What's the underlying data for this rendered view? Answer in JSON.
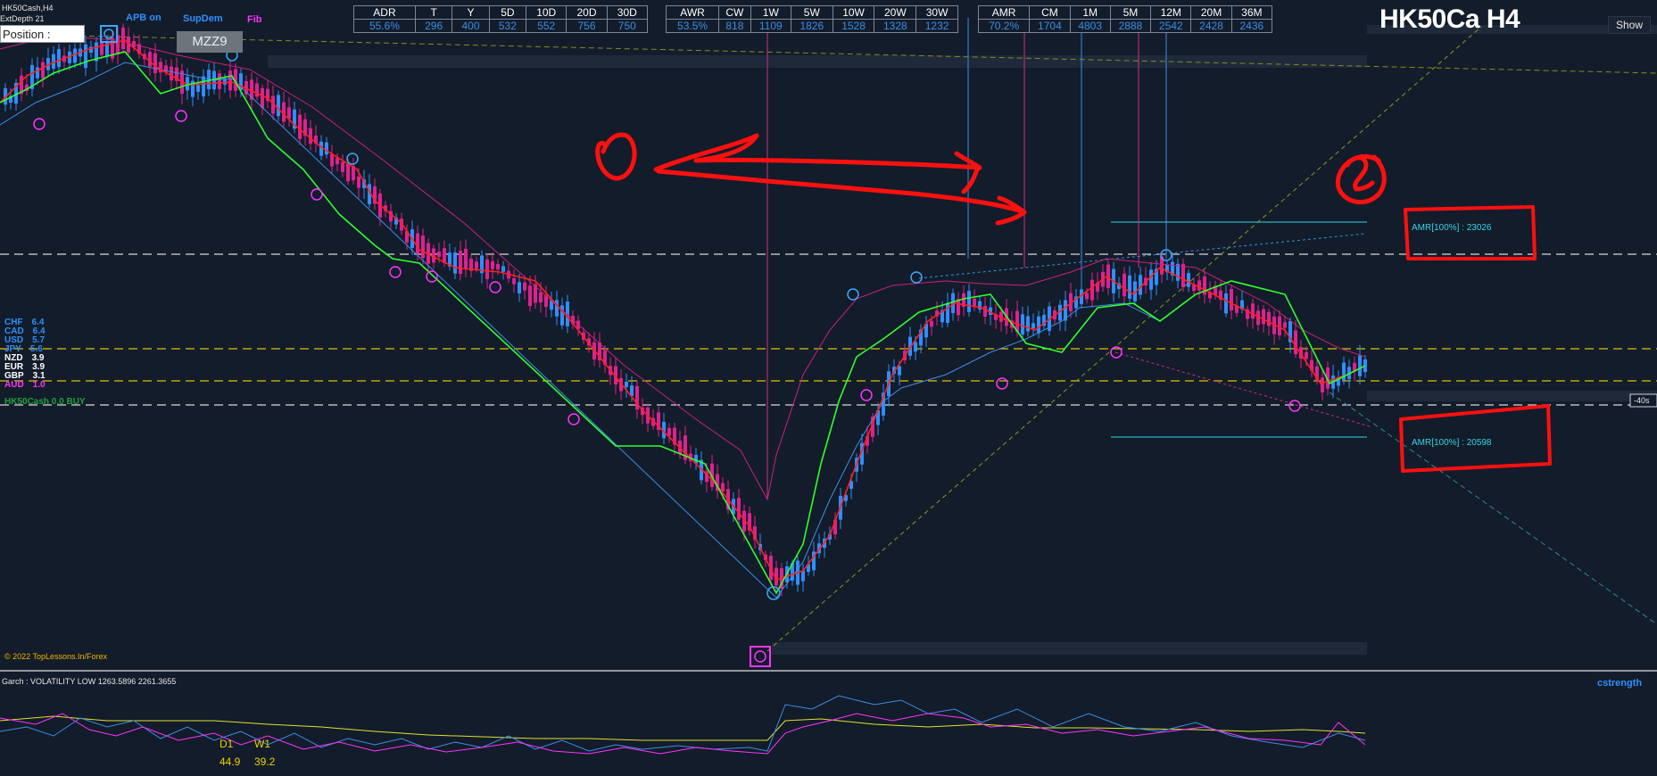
{
  "symbol_info": {
    "line1": "HK50Cash,H4",
    "line2": "ExtDepth  21"
  },
  "top_buttons": {
    "apb": "APB on",
    "supdem": "SupDem",
    "fib": "Fib",
    "position": "Position :",
    "mzz": "MZZ9"
  },
  "title": "HK50Ca H4",
  "show_button": "Show",
  "table1": {
    "headers": [
      "ADR",
      "T",
      "Y",
      "5D",
      "10D",
      "20D",
      "30D"
    ],
    "values": [
      "55.6%",
      "296",
      "400",
      "532",
      "552",
      "756",
      "750"
    ]
  },
  "table2": {
    "headers": [
      "AWR",
      "CW",
      "1W",
      "5W",
      "10W",
      "20W",
      "30W"
    ],
    "values": [
      "53.5%",
      "818",
      "1109",
      "1826",
      "1528",
      "1328",
      "1232"
    ]
  },
  "table3": {
    "headers": [
      "AMR",
      "CM",
      "1M",
      "5M",
      "12M",
      "20M",
      "36M"
    ],
    "values": [
      "70.2%",
      "1704",
      "4803",
      "2888",
      "2542",
      "2428",
      "2436"
    ]
  },
  "currency_strength": [
    {
      "name": "CHF",
      "value": "6.4",
      "color": "#2e8fff"
    },
    {
      "name": "CAD",
      "value": "6.4",
      "color": "#2e8fff"
    },
    {
      "name": "USD",
      "value": "5.7",
      "color": "#2e8fff"
    },
    {
      "name": "JPY",
      "value": "5.6",
      "color": "#2e8fff"
    },
    {
      "name": "NZD",
      "value": "3.9",
      "color": "#ffffff"
    },
    {
      "name": "EUR",
      "value": "3.9",
      "color": "#ffffff"
    },
    {
      "name": "GBP",
      "value": "3.1",
      "color": "#ffffff"
    },
    {
      "name": "AUD",
      "value": "1.0",
      "color": "#ff33ff"
    }
  ],
  "signal_text": "HK50Cash 0.0 BUY",
  "amr_upper": "AMR[100%] : 23026",
  "amr_lower": "AMR[100%] : 20598",
  "copyright": "© 2022 TopLessons.In/Forex",
  "garch": "Garch : VOLATILITY LOW 1263.5896 2261.3655",
  "cstrength": "cstrength",
  "dw_labels": {
    "d1": "D1",
    "w1": "W1",
    "d1_val": "44.9",
    "w1_val": "39.2"
  },
  "price_tag": "-40s",
  "annotations": {
    "one": "1",
    "two": "2"
  },
  "colors": {
    "background": "#131c2a",
    "bull": "#2e8fff",
    "bear": "#e0208f",
    "ma_red": "#ff2020",
    "ma_green": "#30ff30",
    "annot": "#ff0000"
  }
}
